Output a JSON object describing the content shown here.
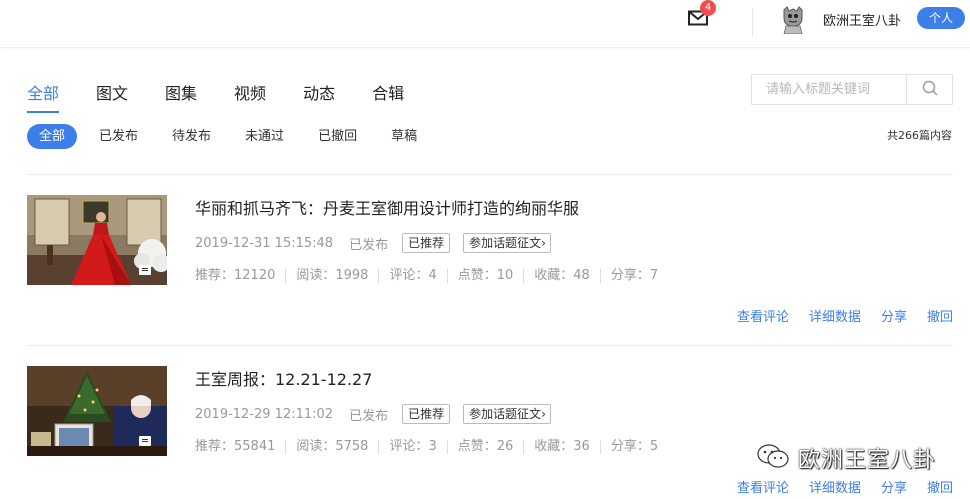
{
  "header": {
    "mail_badge": "4",
    "username": "欧洲王室八卦",
    "personal_label": "个人"
  },
  "tabs": [
    {
      "label": "全部"
    },
    {
      "label": "图文"
    },
    {
      "label": "图集"
    },
    {
      "label": "视频"
    },
    {
      "label": "动态"
    },
    {
      "label": "合辑"
    }
  ],
  "search": {
    "placeholder": "请输入标题关键词"
  },
  "filters": [
    {
      "label": "全部"
    },
    {
      "label": "已发布"
    },
    {
      "label": "待发布"
    },
    {
      "label": "未通过"
    },
    {
      "label": "已撤回"
    },
    {
      "label": "草稿"
    }
  ],
  "total_count": "共266篇内容",
  "articles": [
    {
      "title": "华丽和抓马齐飞：丹麦王室御用设计师打造的绚丽华服",
      "date": "2019-12-31 15:15:48",
      "status": "已发布",
      "tag_recommended": "已推荐",
      "tag_topic": "参加话题征文",
      "stats": [
        "推荐：12120",
        "阅读：1998",
        "评论：4",
        "点赞：10",
        "收藏：48",
        "分享：7"
      ],
      "actions": [
        "查看评论",
        "详细数据",
        "分享",
        "撤回"
      ]
    },
    {
      "title": "王室周报：12.21-12.27",
      "date": "2019-12-29 12:11:02",
      "status": "已发布",
      "tag_recommended": "已推荐",
      "tag_topic": "参加话题征文",
      "stats": [
        "推荐：55841",
        "阅读：5758",
        "评论：3",
        "点赞：26",
        "收藏：36",
        "分享：5"
      ],
      "actions": [
        "查看评论",
        "详细数据",
        "分享",
        "撤回"
      ]
    }
  ],
  "watermark": "欧洲王室八卦",
  "colors": {
    "accent": "#3d7fe8",
    "badge": "#f04e4e"
  }
}
